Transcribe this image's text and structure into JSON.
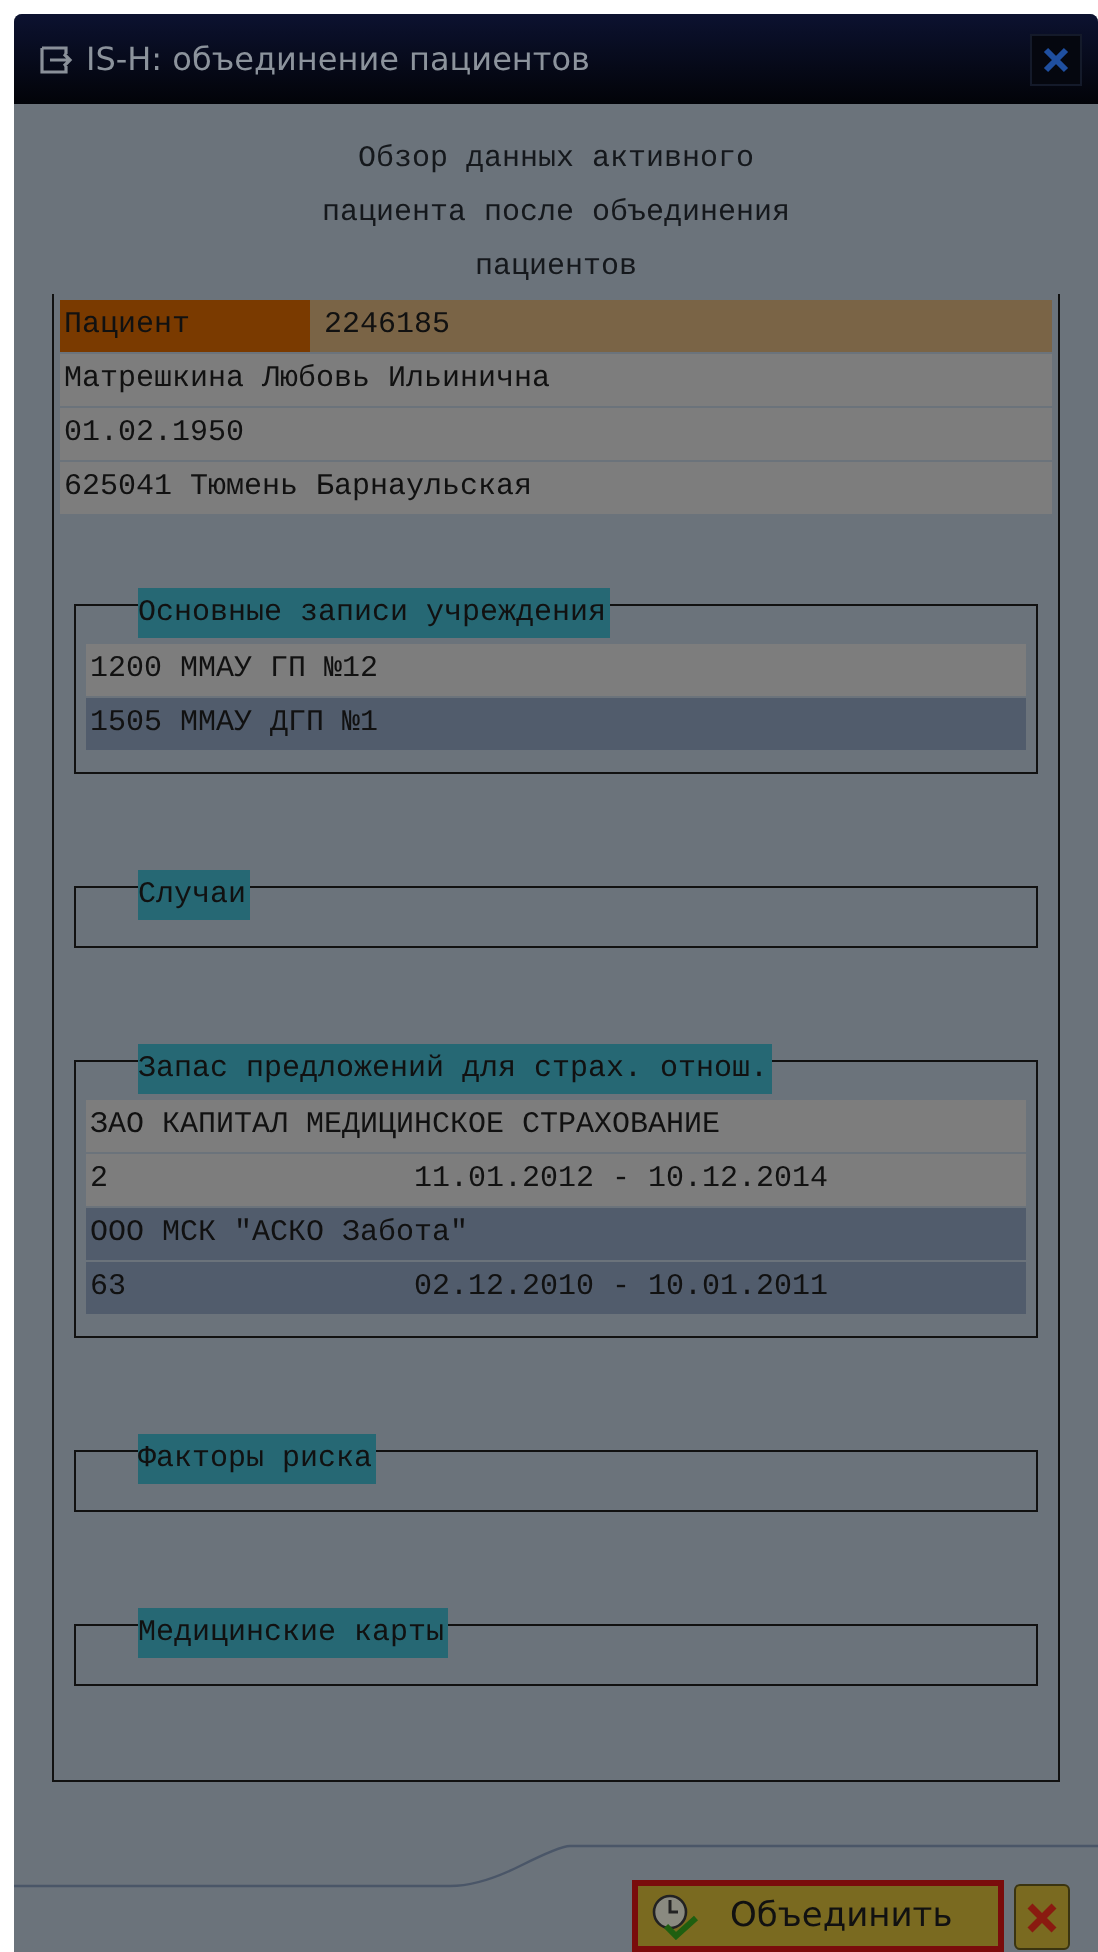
{
  "window": {
    "title": "IS-H: объединение пациентов"
  },
  "heading": "Обзор данных активного пациента после объединения пациентов",
  "patient": {
    "label": "Пациент",
    "number": "2246185",
    "lines": [
      "Матрешкина Любовь Ильинична",
      "01.02.1950",
      "625041 Тюмень Барнаульская"
    ]
  },
  "groups": [
    {
      "kind": "list",
      "title": "Основные записи учреждения",
      "entries": [
        {
          "text": "1200 ММАУ ГП №12"
        },
        {
          "text": "1505 ММАУ ДГП №1"
        }
      ]
    },
    {
      "title": "Случаи"
    },
    {
      "kind": "insurance",
      "title": "Запас предложений для страх. отнош.",
      "entries": [
        {
          "name": "ЗАО КАПИТАЛ МЕДИЦИНСКОЕ СТРАХОВАНИЕ",
          "number": "2",
          "period": "11.01.2012 - 10.12.2014"
        },
        {
          "name": "ООО МСК \"АСКО Забота\"",
          "number": "63",
          "period": "02.12.2010 - 10.01.2011"
        }
      ]
    },
    {
      "title": "Факторы риска"
    },
    {
      "title": "Медицинские карты"
    }
  ],
  "buttons": [
    {
      "kind": "merge",
      "label": "Объединить"
    },
    {
      "kind": "cancel"
    }
  ]
}
